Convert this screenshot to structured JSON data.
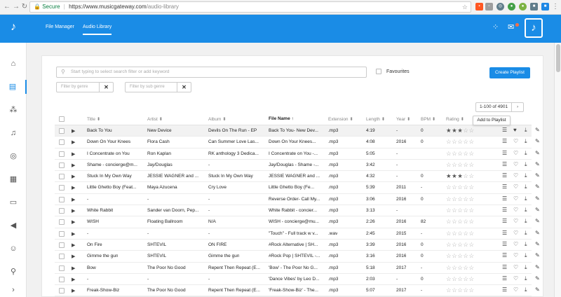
{
  "browser": {
    "secure_label": "Secure",
    "url_host": "https://www.musicgateway.com",
    "url_path": "/audio-library"
  },
  "header": {
    "nav": [
      {
        "label": "File Manager"
      },
      {
        "label": "Audio Library"
      }
    ]
  },
  "toolbar": {
    "search_placeholder": "Start typing to select search filter or add keyword",
    "favourites_label": "Favourites",
    "create_playlist_label": "Create Playlist",
    "genre_placeholder": "Filter by genre",
    "subgenre_placeholder": "Filter by sub genre",
    "clear_symbol": "✕",
    "pagination_range": "1-100 of 4901",
    "next_symbol": "›",
    "tooltip": "Add to Playlist"
  },
  "table": {
    "columns": [
      "Title",
      "Artist",
      "Album",
      "File Name",
      "Extension",
      "Length",
      "Year",
      "BPM",
      "Rating"
    ],
    "sort_icon": "⬍",
    "active_sort_icon": "↑",
    "rows": [
      {
        "title": "Back To You",
        "artist": "New Device",
        "album": "Devils On The Run - EP",
        "file": "Back To You- New Dev...",
        "ext": ".mp3",
        "length": "4:19",
        "year": "-",
        "bpm": "0",
        "rating": 3,
        "liked": true,
        "highlight": true
      },
      {
        "title": "Down On Your Knees",
        "artist": "Flora Cash",
        "album": "Can Summer Love Las...",
        "file": "Down On Your Knees...",
        "ext": ".mp3",
        "length": "4:08",
        "year": "2016",
        "bpm": "0",
        "rating": 0,
        "liked": false,
        "highlight": false
      },
      {
        "title": "I Concentrate on You",
        "artist": "Ron Kaplan",
        "album": "RK anthology 3 Dedica...",
        "file": "I Concentrate on You -...",
        "ext": ".mp3",
        "length": "5:05",
        "year": "-",
        "bpm": "",
        "rating": 0,
        "liked": false,
        "highlight": false
      },
      {
        "title": "Shame - concierge@m...",
        "artist": "Jay/Douglas",
        "album": "-",
        "file": "Jay/Douglas - Shame -...",
        "ext": ".mp3",
        "length": "3:42",
        "year": "-",
        "bpm": "",
        "rating": 0,
        "liked": false,
        "highlight": false
      },
      {
        "title": "Stuck In My Own Way",
        "artist": "JESSIE WAGNER and ...",
        "album": "Stuck In My Own Way",
        "file": "JESSIE WAGNER and ...",
        "ext": ".mp3",
        "length": "4:32",
        "year": "-",
        "bpm": "0",
        "rating": 3,
        "liked": false,
        "highlight": false
      },
      {
        "title": "Little Ghetto Boy (Feat...",
        "artist": "Maya Azucena",
        "album": "Cry Love",
        "file": "Little Ghetto Boy (Fe...",
        "ext": ".mp3",
        "length": "5:39",
        "year": "2011",
        "bpm": "-",
        "rating": 0,
        "liked": false,
        "highlight": false
      },
      {
        "title": "-",
        "artist": "-",
        "album": "-",
        "file": "Reverse Order- Call My...",
        "ext": ".mp3",
        "length": "3:06",
        "year": "2016",
        "bpm": "0",
        "rating": 0,
        "liked": false,
        "highlight": false
      },
      {
        "title": "White Rabbit",
        "artist": "Sander van Doorn, Pep...",
        "album": "-",
        "file": "White Rabbit - concier...",
        "ext": ".mp3",
        "length": "3:13",
        "year": "-",
        "bpm": "",
        "rating": 0,
        "liked": false,
        "highlight": false
      },
      {
        "title": "WISH",
        "artist": "Floating Ballroom",
        "album": "N/A",
        "file": "WISH - concierge@mu...",
        "ext": ".mp3",
        "length": "2:26",
        "year": "2016",
        "bpm": "82",
        "rating": 0,
        "liked": false,
        "highlight": false
      },
      {
        "title": "-",
        "artist": "-",
        "album": "-",
        "file": "\"Touch\" - Full track w v...",
        "ext": ".wav",
        "length": "2:45",
        "year": "2015",
        "bpm": "-",
        "rating": 0,
        "liked": false,
        "highlight": false
      },
      {
        "title": "On Fire",
        "artist": "SHTEVIL",
        "album": "ON FIRE",
        "file": "#Rock Alternative | SH...",
        "ext": ".mp3",
        "length": "3:39",
        "year": "2016",
        "bpm": "0",
        "rating": 0,
        "liked": false,
        "highlight": false
      },
      {
        "title": "Gimme the gun",
        "artist": "SHTEVIL",
        "album": "Gimme the gun",
        "file": "#Rock Pop | SHTEVIL -...",
        "ext": ".mp3",
        "length": "3:16",
        "year": "2016",
        "bpm": "0",
        "rating": 0,
        "liked": false,
        "highlight": false
      },
      {
        "title": "Bow",
        "artist": "The Poor No Good",
        "album": "Repent Then Repeat (E...",
        "file": "'Bow' - The Poor No G...",
        "ext": ".mp3",
        "length": "5:18",
        "year": "2017",
        "bpm": "-",
        "rating": 0,
        "liked": false,
        "highlight": false
      },
      {
        "title": "-",
        "artist": "-",
        "album": "-",
        "file": "'Dance Vibes' by Leo D...",
        "ext": ".mp3",
        "length": "2:03",
        "year": "-",
        "bpm": "0",
        "rating": 0,
        "liked": false,
        "highlight": false
      },
      {
        "title": "Freak-Show-Biz",
        "artist": "The Poor No Good",
        "album": "Repent Then Repeat (E...",
        "file": "'Freak-Show-Biz' - The...",
        "ext": ".mp3",
        "length": "5:07",
        "year": "2017",
        "bpm": "-",
        "rating": 0,
        "liked": false,
        "highlight": false
      }
    ]
  },
  "icons": {
    "back": "back-arrow-icon",
    "forward": "forward-arrow-icon",
    "reload": "reload-icon",
    "play": "play-icon",
    "add_to_playlist": "add-to-playlist-icon",
    "heart": "heart-icon",
    "download": "download-icon",
    "edit": "pencil-icon"
  },
  "colors": {
    "brand_blue": "#1a8ce6",
    "secure_green": "#0b8043"
  }
}
